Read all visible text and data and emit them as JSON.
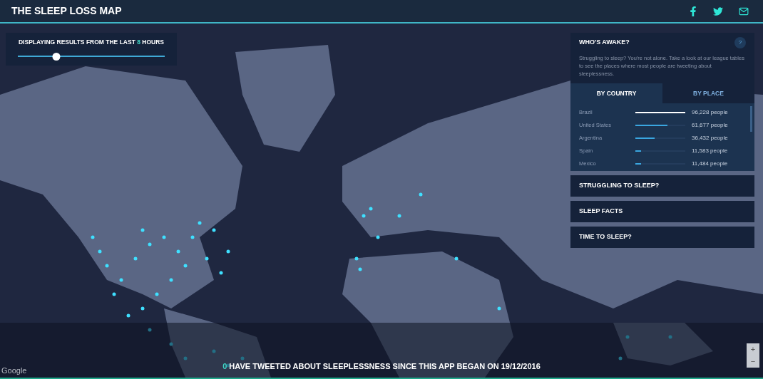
{
  "header": {
    "title": "THE SLEEP LOSS MAP",
    "share": [
      {
        "kind": "facebook"
      },
      {
        "kind": "twitter"
      },
      {
        "kind": "email"
      }
    ]
  },
  "time_filter": {
    "prefix": "DISPLAYING RESULTS FROM THE LAST",
    "value": "8",
    "suffix": "HOURS",
    "level": 0.26
  },
  "panel": {
    "title": "WHO'S AWAKE?",
    "help": "?",
    "description": "Struggling to sleep? You're not alone. Take a look at our league tables to see the places where most people are tweeting about sleeplessness.",
    "tabs": [
      {
        "label": "BY COUNTRY",
        "selected": true
      },
      {
        "label": "BY PLACE",
        "selected": false
      }
    ],
    "rows": [
      {
        "name": "Brazil",
        "level": 1,
        "reading": "96,228 people"
      },
      {
        "name": "United States",
        "level": 0.64,
        "reading": "61,677 people"
      },
      {
        "name": "Argentina",
        "level": 0.38,
        "reading": "36,432 people"
      },
      {
        "name": "Spain",
        "level": 0.12,
        "reading": "11,583 people"
      },
      {
        "name": "Mexico",
        "level": 0.12,
        "reading": "11,484 people"
      }
    ],
    "sections": [
      {
        "label": "STRUGGLING TO SLEEP?",
        "expanded": false
      },
      {
        "label": "SLEEP FACTS",
        "expanded": false
      },
      {
        "label": "TIME TO SLEEP?",
        "expanded": false
      }
    ]
  },
  "map": {
    "zoom_in": "+",
    "zoom_out": "−",
    "attribution": "Google"
  },
  "footer": {
    "count": "0",
    "text": "HAVE TWEETED ABOUT SLEEPLESSNESS SINCE THIS APP BEGAN ON 19/12/2016"
  }
}
